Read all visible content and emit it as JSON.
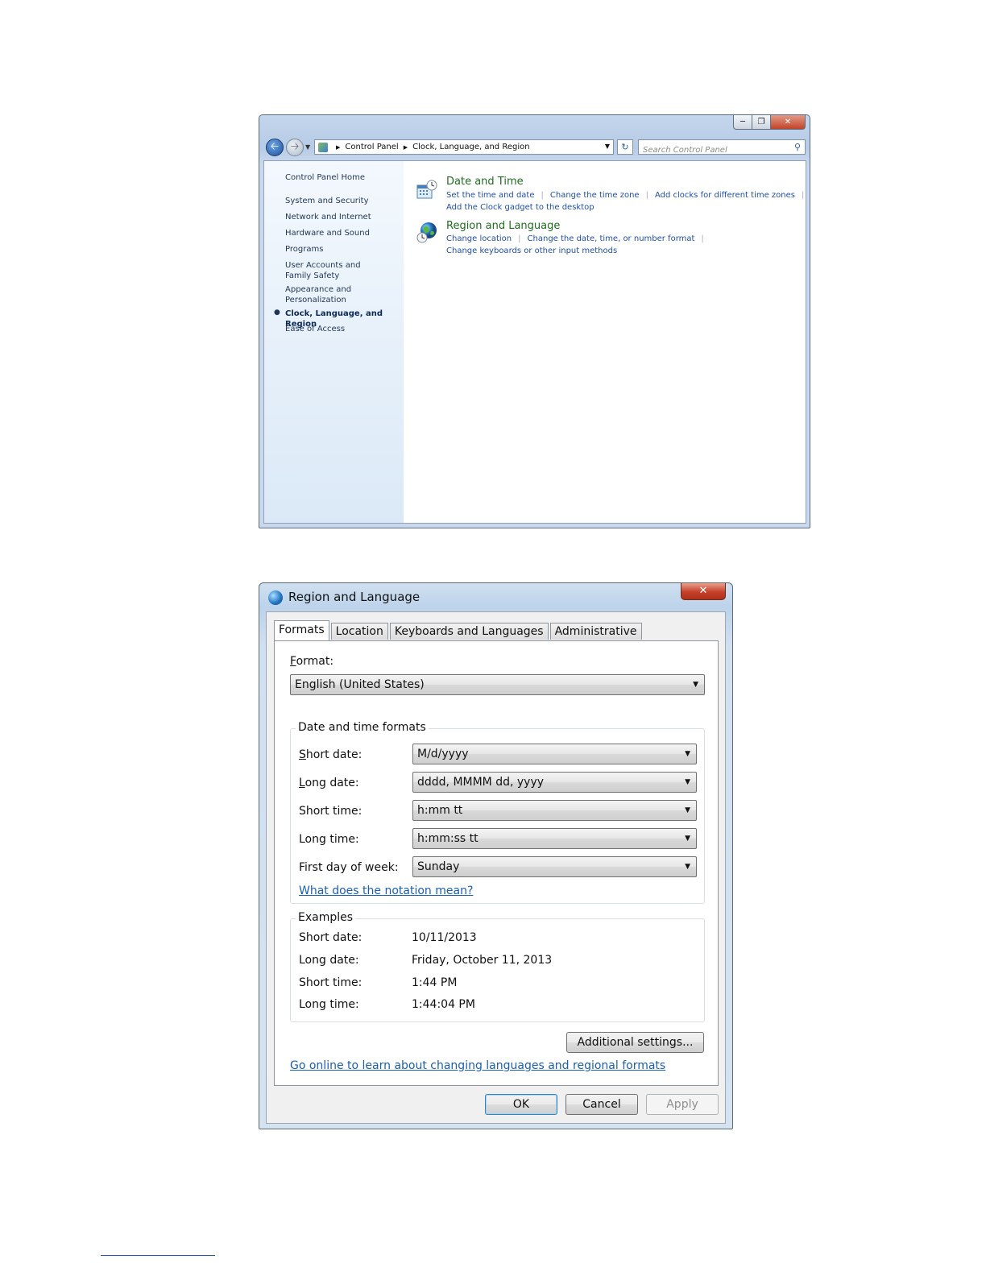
{
  "control_panel": {
    "address": {
      "crumb1": "Control Panel",
      "crumb2": "Clock, Language, and Region"
    },
    "search_placeholder": "Search Control Panel",
    "left_nav": {
      "home": "Control Panel Home",
      "items": [
        "System and Security",
        "Network and Internet",
        "Hardware and Sound",
        "Programs",
        "User Accounts and Family Safety",
        "Appearance and Personalization",
        "Clock, Language, and Region",
        "Ease of Access"
      ],
      "current_item": "Clock, Language, and Region"
    },
    "categories": [
      {
        "title": "Date and Time",
        "links": [
          "Set the time and date",
          "Change the time zone",
          "Add clocks for different time zones",
          "Add the Clock gadget to the desktop"
        ]
      },
      {
        "title": "Region and Language",
        "links": [
          "Change location",
          "Change the date, time, or number format",
          "Change keyboards or other input methods"
        ]
      }
    ]
  },
  "region_dialog": {
    "title": "Region and Language",
    "tabs": [
      "Formats",
      "Location",
      "Keyboards and Languages",
      "Administrative"
    ],
    "active_tab": "Formats",
    "format": {
      "label": "Format:",
      "value": "English (United States)"
    },
    "date_time_formats": {
      "title": "Date and time formats",
      "rows": [
        {
          "label": "Short date:",
          "value": "M/d/yyyy"
        },
        {
          "label": "Long date:",
          "value": "dddd, MMMM dd, yyyy"
        },
        {
          "label": "Short time:",
          "value": "h:mm tt"
        },
        {
          "label": "Long time:",
          "value": "h:mm:ss tt"
        },
        {
          "label": "First day of week:",
          "value": "Sunday"
        }
      ],
      "notation_link": "What does the notation mean?"
    },
    "examples": {
      "title": "Examples",
      "rows": [
        {
          "label": "Short date:",
          "value": "10/11/2013"
        },
        {
          "label": "Long date:",
          "value": "Friday, October 11, 2013"
        },
        {
          "label": "Short time:",
          "value": "1:44 PM"
        },
        {
          "label": "Long time:",
          "value": "1:44:04 PM"
        }
      ]
    },
    "additional_settings": "Additional settings...",
    "online_link": "Go online to learn about changing languages and regional formats",
    "buttons": {
      "ok": "OK",
      "cancel": "Cancel",
      "apply": "Apply"
    }
  }
}
